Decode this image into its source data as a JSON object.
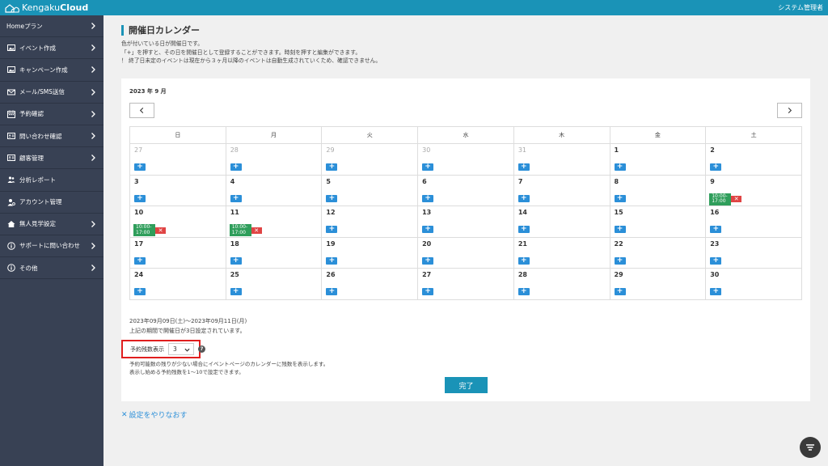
{
  "app": {
    "logo_part1": "Kengaku",
    "logo_part2": "Cloud",
    "user": "システム管理者"
  },
  "sidebar": {
    "items": [
      {
        "label": "Homeプラン",
        "icon": "none",
        "chevron": true
      },
      {
        "label": "イベント作成",
        "icon": "image-icon",
        "chevron": true
      },
      {
        "label": "キャンペーン作成",
        "icon": "image-icon",
        "chevron": true
      },
      {
        "label": "メール/SMS送信",
        "icon": "mail-icon",
        "chevron": true
      },
      {
        "label": "予約確認",
        "icon": "calendar-icon",
        "chevron": true
      },
      {
        "label": "問い合わせ確認",
        "icon": "id-card-icon",
        "chevron": true
      },
      {
        "label": "顧客管理",
        "icon": "id-card-icon",
        "chevron": true
      },
      {
        "label": "分析レポート",
        "icon": "users-icon",
        "chevron": false
      },
      {
        "label": "アカウント管理",
        "icon": "user-gear-icon",
        "chevron": false
      },
      {
        "label": "無人見学設定",
        "icon": "home-icon",
        "chevron": true
      },
      {
        "label": "サポートに問い合わせ",
        "icon": "info-icon",
        "chevron": true
      },
      {
        "label": "その他",
        "icon": "info-icon",
        "chevron": true
      }
    ]
  },
  "page": {
    "title": "開催日カレンダー",
    "intro": [
      "色が付いている日が開催日です。",
      "「+」を押すと、その日を開催日として登録することができます。時刻を押すと編集ができます。",
      "！ 終了日未定のイベントは現在から３ヶ月以降のイベントは自動生成されていくため、確認できません。"
    ]
  },
  "calendar": {
    "month_label": "2023 年 9 月",
    "weekdays": [
      "日",
      "月",
      "火",
      "水",
      "木",
      "金",
      "土"
    ],
    "plus_label": "+",
    "weeks": [
      [
        {
          "d": "27",
          "m": true
        },
        {
          "d": "28",
          "m": true
        },
        {
          "d": "29",
          "m": true
        },
        {
          "d": "30",
          "m": true
        },
        {
          "d": "31",
          "m": true
        },
        {
          "d": "1"
        },
        {
          "d": "2"
        }
      ],
      [
        {
          "d": "3"
        },
        {
          "d": "4"
        },
        {
          "d": "5"
        },
        {
          "d": "6"
        },
        {
          "d": "7"
        },
        {
          "d": "8"
        },
        {
          "d": "9",
          "e": "10:00-\n17:00"
        }
      ],
      [
        {
          "d": "10",
          "e": "10:00-\n17:00"
        },
        {
          "d": "11",
          "e": "10:00-\n17:00"
        },
        {
          "d": "12"
        },
        {
          "d": "13"
        },
        {
          "d": "14"
        },
        {
          "d": "15"
        },
        {
          "d": "16"
        }
      ],
      [
        {
          "d": "17"
        },
        {
          "d": "18"
        },
        {
          "d": "19"
        },
        {
          "d": "20"
        },
        {
          "d": "21"
        },
        {
          "d": "22"
        },
        {
          "d": "23"
        }
      ],
      [
        {
          "d": "24"
        },
        {
          "d": "25"
        },
        {
          "d": "26"
        },
        {
          "d": "27"
        },
        {
          "d": "28"
        },
        {
          "d": "29"
        },
        {
          "d": "30"
        }
      ]
    ]
  },
  "summary": {
    "range": "2023年09月09日(土)～2023年09月11日(月)",
    "note": "上記の期間で開催日が3日設定されています。"
  },
  "remaining": {
    "label": "予約残数表示",
    "value": "3",
    "help": "?",
    "desc": [
      "予約可能数の残りが少ない場合にイベントページのカレンダーに残数を表示します。",
      "表示し始める予約残数を1～10で設定できます。"
    ]
  },
  "actions": {
    "done": "完了",
    "reset": "設定をやりなおす",
    "reset_x": "✕"
  },
  "colors": {
    "topbar": "#1a93b7",
    "sidebar": "#384154",
    "event_green": "#2f9e5b",
    "delete_red": "#e04444",
    "plus_blue": "#2b8fd8",
    "highlight_red": "#e01e1e"
  }
}
